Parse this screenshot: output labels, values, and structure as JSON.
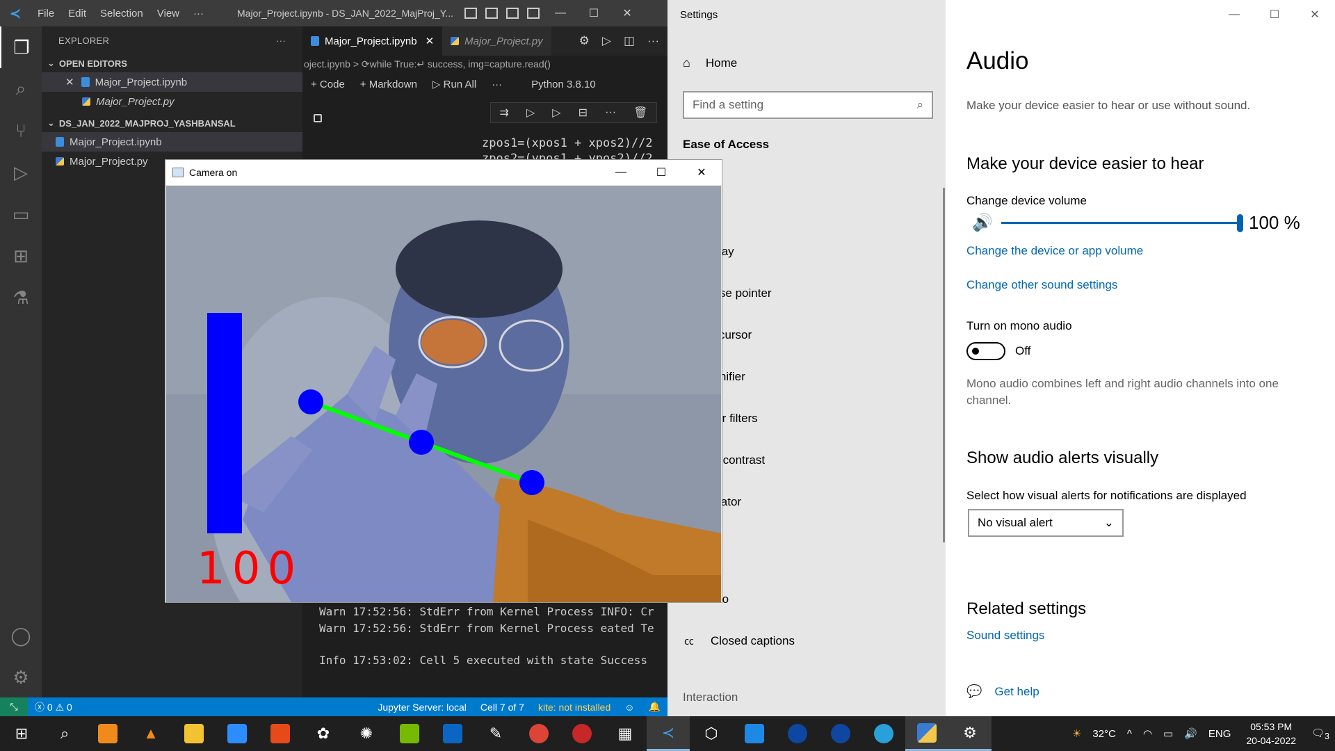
{
  "vscode": {
    "menu": [
      "File",
      "Edit",
      "Selection",
      "View",
      "···"
    ],
    "window_title": "Major_Project.ipynb - DS_JAN_2022_MajProj_Y...",
    "explorer": {
      "title": "EXPLORER",
      "open_editors_label": "OPEN EDITORS",
      "open_editors": [
        "Major_Project.ipynb",
        "Major_Project.py"
      ],
      "folder_label": "DS_JAN_2022_MAJPROJ_YASHBANSAL",
      "files": [
        "Major_Project.ipynb",
        "Major_Project.py"
      ]
    },
    "tabs": [
      "Major_Project.ipynb",
      "Major_Project.py"
    ],
    "breadcrumb": "oject.ipynb > ⟳while True:↵   success, img=capture.read()",
    "toolbar": {
      "code": "+ Code",
      "markdown": "+ Markdown",
      "run_all": "▷ Run All",
      "more": "···",
      "kernel": "Python 3.8.10"
    },
    "code_lines": [
      "zpos1=(xpos1 + xpos2)//2",
      "zpos2=(ypos1 + ypos2)//2"
    ],
    "output_lines": [
      "Warn 17:52:56: StdErr from Kernel Process INFO: Cr",
      "Warn 17:52:56: StdErr from Kernel Process eated Te",
      "Info 17:53:02: Cell 5 executed with state Success"
    ],
    "status": {
      "errors": "ⓧ 0 ⚠ 0",
      "jupyter": "Jupyter Server: local",
      "cell": "Cell 7 of 7",
      "kite": "kite: not installed"
    }
  },
  "camera": {
    "title": "Camera on",
    "volume_text": "100",
    "volume_bar_fraction": 1.0
  },
  "settings": {
    "window_title": "Settings",
    "home": "Home",
    "search_placeholder": "Find a setting",
    "group": "Ease of Access",
    "nav_items": [
      "splay",
      "ouse pointer",
      "xt cursor",
      "agnifier",
      "olor filters",
      "gh contrast",
      "arrator",
      "udio",
      "Closed captions"
    ],
    "nav_sub": "Interaction",
    "page_title": "Audio",
    "page_subtitle": "Make your device easier to hear or use without sound.",
    "hear_heading": "Make your device easier to hear",
    "volume_label": "Change device volume",
    "volume_value": "100 %",
    "volume_level": 1.0,
    "link_device_volume": "Change the device or app volume",
    "link_other_sound": "Change other sound settings",
    "mono_label": "Turn on mono audio",
    "mono_state": "Off",
    "mono_desc": "Mono audio combines left and right audio channels into one channel.",
    "alerts_heading": "Show audio alerts visually",
    "alerts_label": "Select how visual alerts for notifications are displayed",
    "alerts_value": "No visual alert",
    "related_heading": "Related settings",
    "link_sound_settings": "Sound settings",
    "get_help": "Get help"
  },
  "taskbar": {
    "weather": "32°C",
    "lang": "ENG",
    "time": "05:53 PM",
    "date": "20-04-2022",
    "notifications": "3"
  }
}
